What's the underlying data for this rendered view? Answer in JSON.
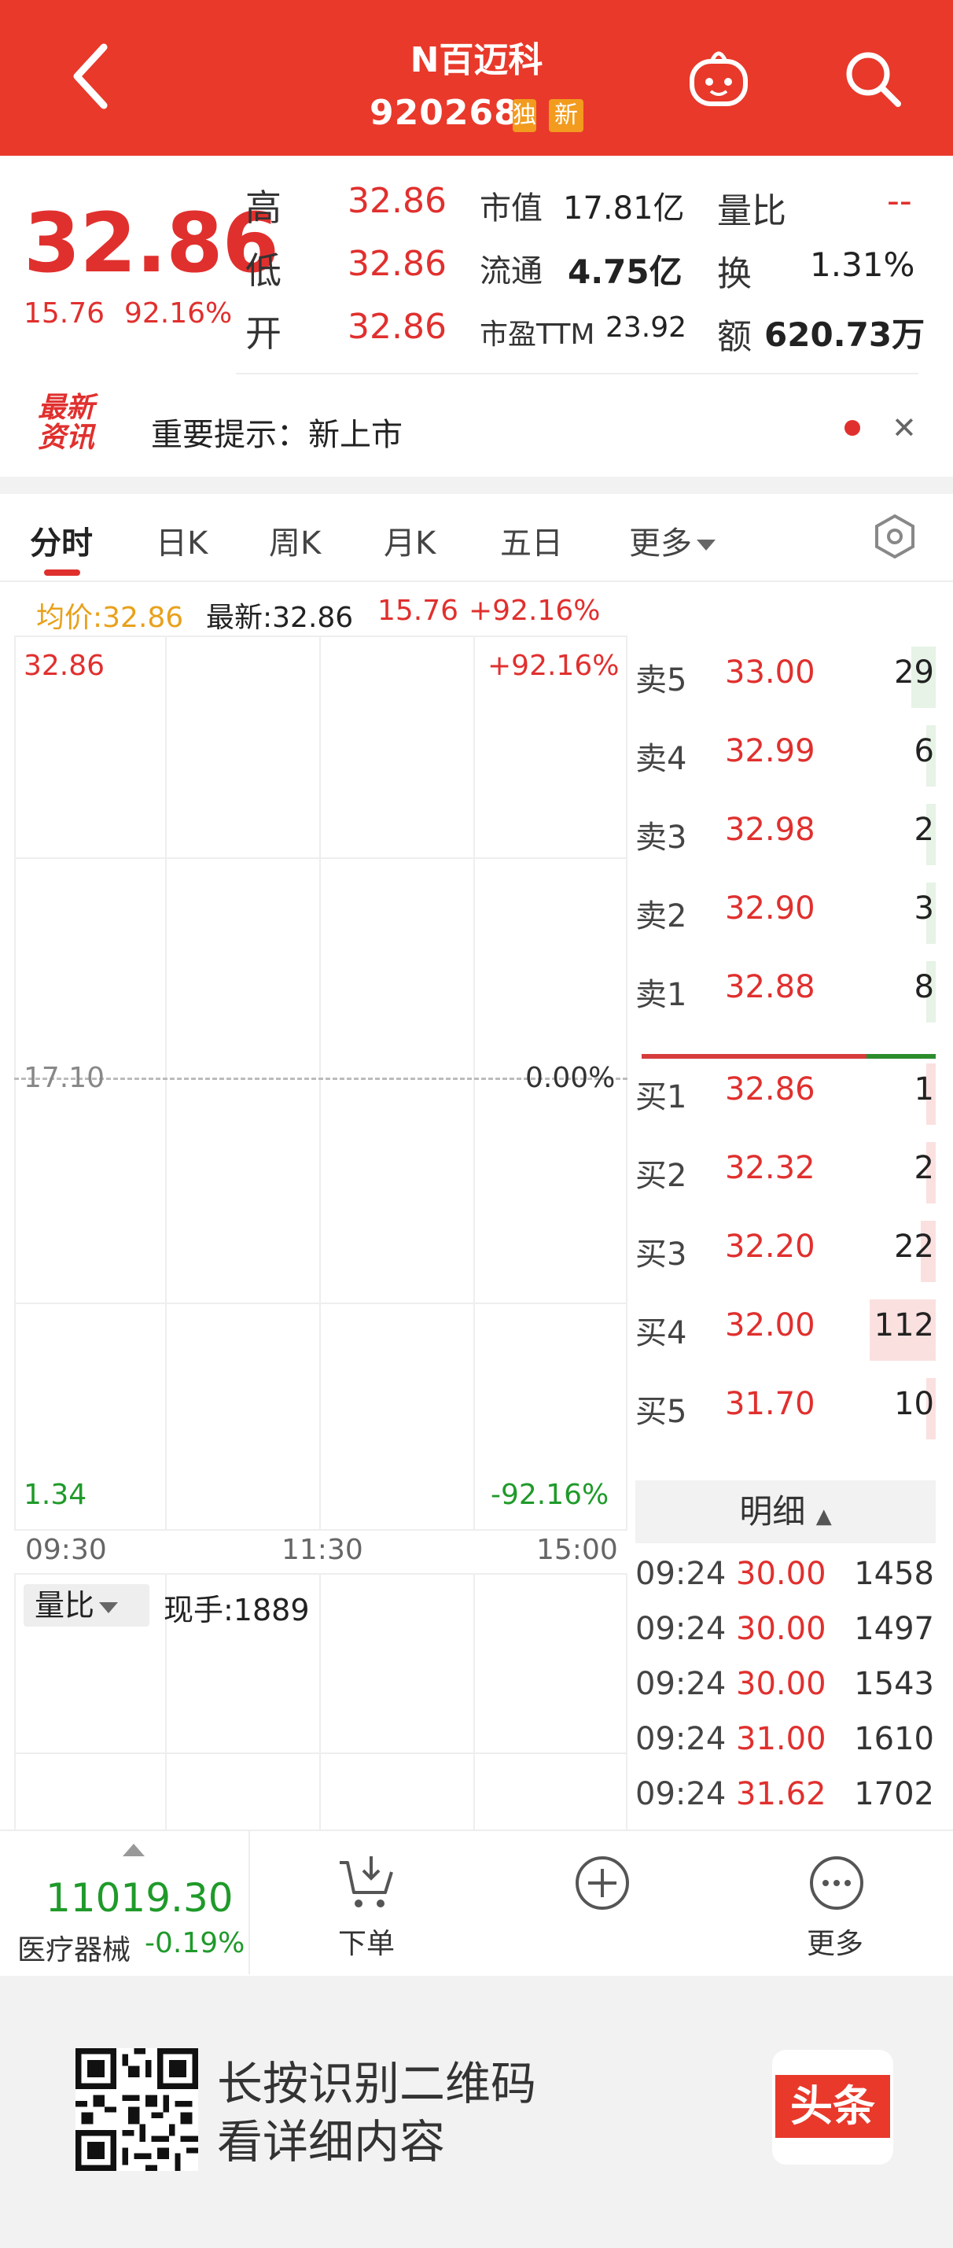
{
  "header": {
    "title": "N百迈科",
    "code": "920268",
    "tag_du": "独",
    "tag_xin": "新"
  },
  "quote": {
    "price": "32.86",
    "change": "15.76",
    "change_pct": "92.16%",
    "high_label": "高",
    "high": "32.86",
    "low_label": "低",
    "low": "32.86",
    "open_label": "开",
    "open": "32.86",
    "mktcap_label": "市值",
    "mktcap": "17.81亿",
    "float_label": "流通",
    "float": "4.75亿",
    "pe_label": "市盈TTM",
    "pe": "23.92",
    "vr_label": "量比",
    "vr": "--",
    "turn_label": "换",
    "turn": "1.31%",
    "amount_label": "额",
    "amount": "620.73万"
  },
  "news": {
    "logo_line1": "最新",
    "logo_line2": "资讯",
    "text": "重要提示：新上市",
    "close": "✕"
  },
  "tabs": [
    "分时",
    "日K",
    "周K",
    "月K",
    "五日",
    "更多"
  ],
  "infoline": {
    "avg": "均价:32.86",
    "latest": "最新:32.86",
    "chg": "15.76",
    "pct": "+92.16%"
  },
  "chart": {
    "y_top": "32.86",
    "y_mid": "17.10",
    "y_bot": "1.34",
    "pct_top": "+92.16%",
    "pct_mid": "0.00%",
    "pct_bot": "-92.16%",
    "x_ticks": [
      "09:30",
      "11:30",
      "15:00"
    ]
  },
  "volume": {
    "selector": "量比",
    "current_hand": "现手:1889"
  },
  "orderbook": {
    "asks": [
      {
        "label": "卖5",
        "price": "33.00",
        "vol": "29",
        "fill": 0.08
      },
      {
        "label": "卖4",
        "price": "32.99",
        "vol": "6",
        "fill": 0.02
      },
      {
        "label": "卖3",
        "price": "32.98",
        "vol": "2",
        "fill": 0.0
      },
      {
        "label": "卖2",
        "price": "32.90",
        "vol": "3",
        "fill": 0.0
      },
      {
        "label": "卖1",
        "price": "32.88",
        "vol": "8",
        "fill": 0.02
      }
    ],
    "bids": [
      {
        "label": "买1",
        "price": "32.86",
        "vol": "1",
        "fill": 0.0
      },
      {
        "label": "买2",
        "price": "32.32",
        "vol": "2",
        "fill": 0.0
      },
      {
        "label": "买3",
        "price": "32.20",
        "vol": "22",
        "fill": 0.05
      },
      {
        "label": "买4",
        "price": "32.00",
        "vol": "112",
        "fill": 0.22
      },
      {
        "label": "买5",
        "price": "31.70",
        "vol": "10",
        "fill": 0.02
      }
    ]
  },
  "detail": {
    "header": "明细",
    "rows": [
      {
        "time": "09:24",
        "price": "30.00",
        "vol": "1458"
      },
      {
        "time": "09:24",
        "price": "30.00",
        "vol": "1497"
      },
      {
        "time": "09:24",
        "price": "30.00",
        "vol": "1543"
      },
      {
        "time": "09:24",
        "price": "31.00",
        "vol": "1610"
      },
      {
        "time": "09:24",
        "price": "31.62",
        "vol": "1702"
      }
    ]
  },
  "bottom": {
    "index_value": "11019.30",
    "index_name": "医疗器械",
    "index_change": "-0.19%",
    "order_label": "下单",
    "more_label": "更多"
  },
  "promo": {
    "line1": "长按识别二维码",
    "line2": "看详细内容",
    "logo": "头条"
  },
  "colors": {
    "brand_red": "#e8392b",
    "up_red": "#e0302e",
    "down_green": "#1f9a2a"
  }
}
